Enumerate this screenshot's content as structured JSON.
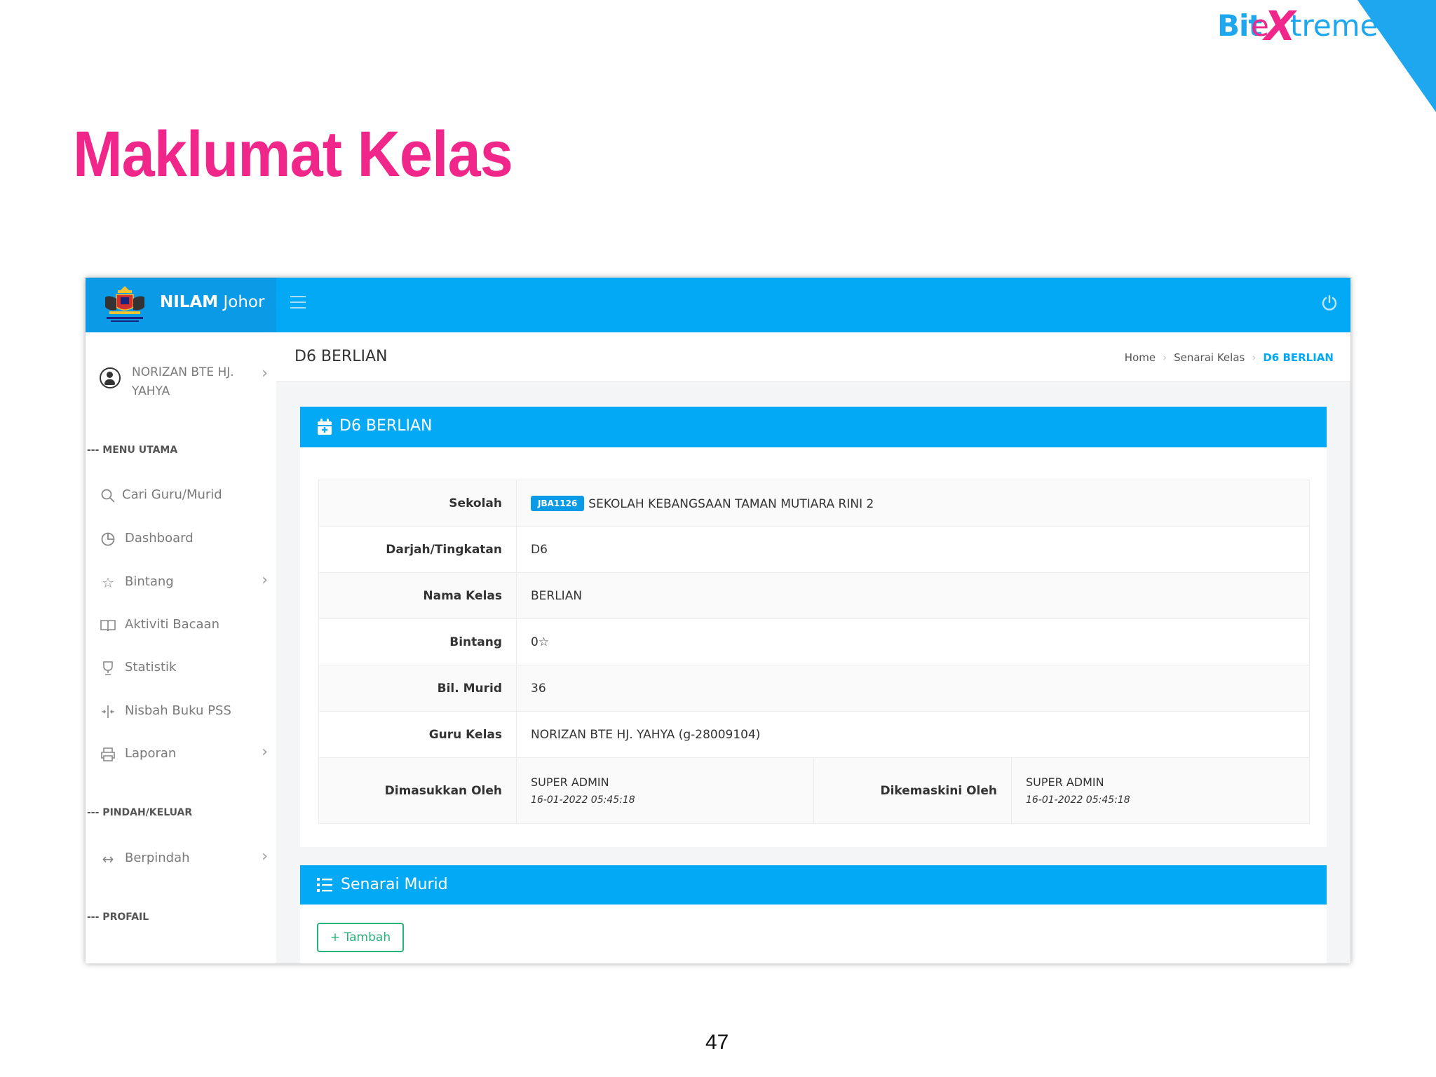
{
  "slide": {
    "logo": {
      "bit": "Bit",
      "e": "e",
      "x": "X",
      "treme": "treme"
    },
    "title": "Maklumat Kelas",
    "page_number": "47"
  },
  "app": {
    "brand_bold": "NILAM",
    "brand_rest": " Johor",
    "icons": {
      "menu": "hamburger-icon",
      "power": "power-icon"
    }
  },
  "sidebar": {
    "user_name": "NORIZAN BTE HJ. YAHYA",
    "sections": {
      "menu": "--- MENU UTAMA",
      "move": "--- PINDAH/KELUAR",
      "profile": "--- PROFAIL"
    },
    "items": [
      {
        "label": "Cari Guru/Murid",
        "icon": "search-icon"
      },
      {
        "label": "Dashboard",
        "icon": "pie-chart-icon"
      },
      {
        "label": "Bintang",
        "icon": "star-icon"
      },
      {
        "label": "Aktiviti Bacaan",
        "icon": "book-icon"
      },
      {
        "label": "Statistik",
        "icon": "trophy-icon"
      },
      {
        "label": "Nisbah Buku PSS",
        "icon": "ratio-icon"
      },
      {
        "label": "Laporan",
        "icon": "printer-icon"
      },
      {
        "label": "Berpindah",
        "icon": "arrows-horizontal-icon"
      }
    ]
  },
  "header": {
    "page_title": "D6 BERLIAN",
    "breadcrumb": [
      "Home",
      "Senarai Kelas",
      "D6 BERLIAN"
    ]
  },
  "class_card": {
    "title": "D6 BERLIAN",
    "rows": {
      "sekolah_label": "Sekolah",
      "sekolah_code": "JBA1126",
      "sekolah_value": "SEKOLAH KEBANGSAAN TAMAN MUTIARA RINI 2",
      "darjah_label": "Darjah/Tingkatan",
      "darjah_value": "D6",
      "nama_label": "Nama Kelas",
      "nama_value": "BERLIAN",
      "bintang_label": "Bintang",
      "bintang_value": "0",
      "bil_label": "Bil. Murid",
      "bil_value": "36",
      "guru_label": "Guru Kelas",
      "guru_value": "NORIZAN BTE HJ. YAHYA (g-28009104)",
      "dimasukkan_label": "Dimasukkan Oleh",
      "dimasukkan_by": "SUPER ADMIN",
      "dimasukkan_at": "16-01-2022 05:45:18",
      "dikemaskini_label": "Dikemaskini Oleh",
      "dikemaskini_by": "SUPER ADMIN",
      "dikemaskini_at": "16-01-2022 05:45:18"
    }
  },
  "students_card": {
    "title": "Senarai Murid",
    "add_button": "Tambah"
  },
  "colors": {
    "primary": "#03a9f4",
    "title_pink": "#f0268a",
    "success": "#26b37a"
  }
}
